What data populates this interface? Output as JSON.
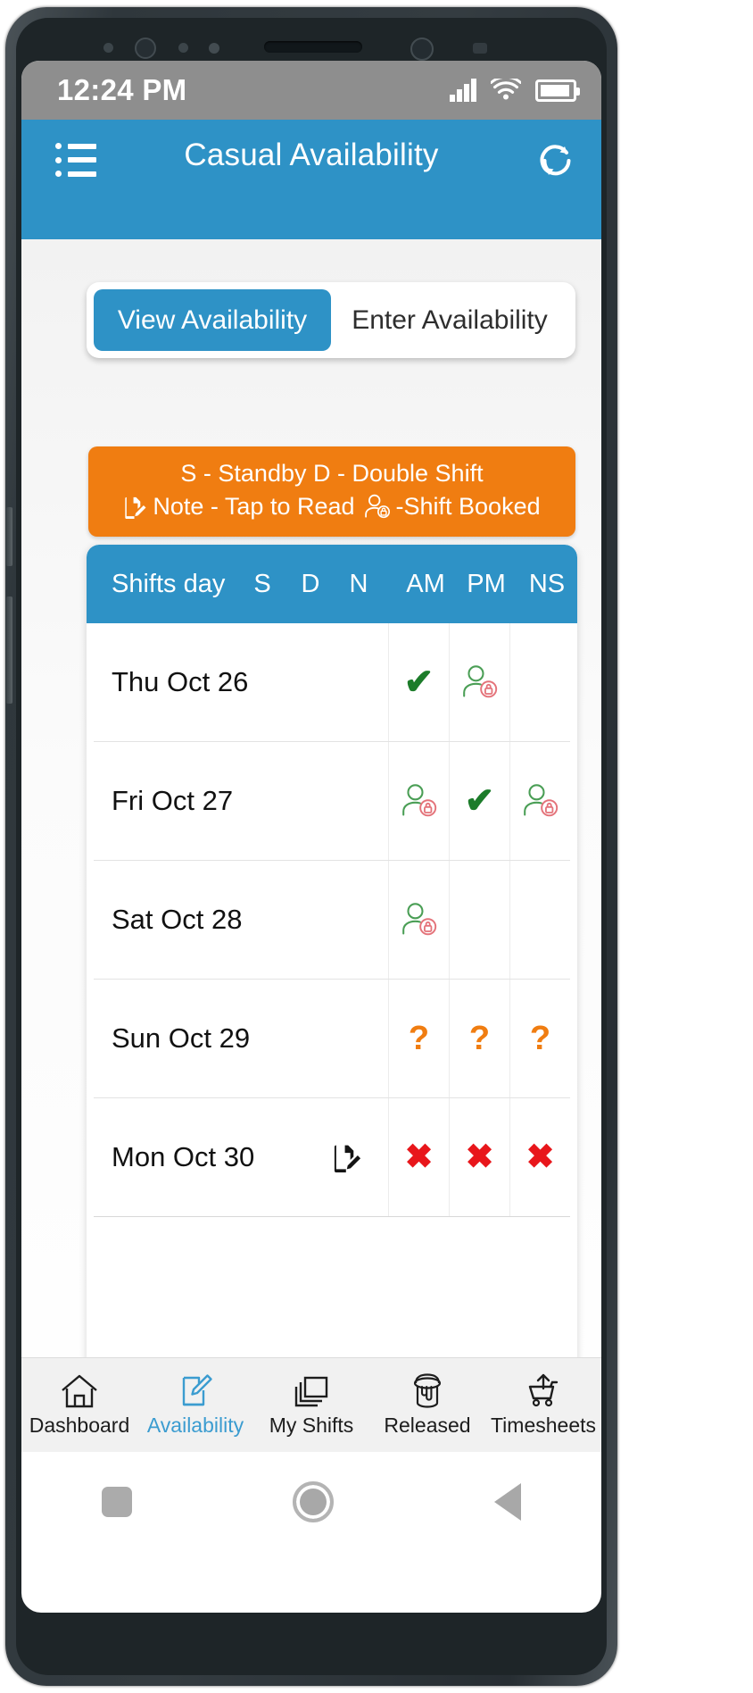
{
  "status_bar": {
    "clock": "12:24 PM",
    "signal_icon": "signal-bars-icon",
    "wifi_icon": "wifi-icon",
    "battery_icon": "battery-full-icon"
  },
  "header": {
    "menu_icon": "hamburger-menu-icon",
    "title": "Casual Availability",
    "refresh_icon": "refresh-icon",
    "accent_color": "#2e92c6"
  },
  "tabs": [
    {
      "label": "View Availability",
      "active": true
    },
    {
      "label": "Enter Availability",
      "active": false
    }
  ],
  "legend": {
    "background_color": "#f07d11",
    "line1": "S - Standby D - Double Shift",
    "note_icon": "note-edit-icon",
    "note_text": "Note - Tap to Read",
    "booked_icon": "person-lock-icon",
    "booked_text": "-Shift Booked"
  },
  "table": {
    "header": {
      "day": "Shifts day",
      "s": "S",
      "d": "D",
      "n": "N",
      "am": "AM",
      "pm": "PM",
      "ns": "NS"
    },
    "rows": [
      {
        "day": "Thu Oct 26",
        "note": null,
        "am": "check",
        "pm": "booked",
        "ns": "empty"
      },
      {
        "day": "Fri Oct 27",
        "note": null,
        "am": "booked",
        "pm": "check",
        "ns": "booked"
      },
      {
        "day": "Sat Oct 28",
        "note": null,
        "am": "booked",
        "pm": "empty",
        "ns": "empty"
      },
      {
        "day": "Sun Oct 29",
        "note": null,
        "am": "question",
        "pm": "question",
        "ns": "question"
      },
      {
        "day": "Mon Oct 30",
        "note": "note-edit-icon",
        "am": "cross",
        "pm": "cross",
        "ns": "cross"
      }
    ],
    "marks": {
      "check": "✔",
      "cross": "✖",
      "question": "?"
    }
  },
  "bottom_nav": [
    {
      "label": "Dashboard",
      "icon": "home-icon",
      "active": false
    },
    {
      "label": "Availability",
      "icon": "pencil-note-icon",
      "active": true
    },
    {
      "label": "My Shifts",
      "icon": "layers-icon",
      "active": false
    },
    {
      "label": "Released",
      "icon": "paint-bucket-icon",
      "active": false
    },
    {
      "label": "Timesheets",
      "icon": "cart-upload-icon",
      "active": false
    }
  ],
  "android_nav": {
    "recent_icon": "square-recents-icon",
    "home_icon": "circle-home-icon",
    "back_icon": "triangle-back-icon"
  },
  "colors": {
    "brand_blue": "#2e92c6",
    "orange": "#f07d11",
    "green": "#1c7c2a",
    "red": "#e8161b",
    "status_gray": "#8e8e8e"
  }
}
